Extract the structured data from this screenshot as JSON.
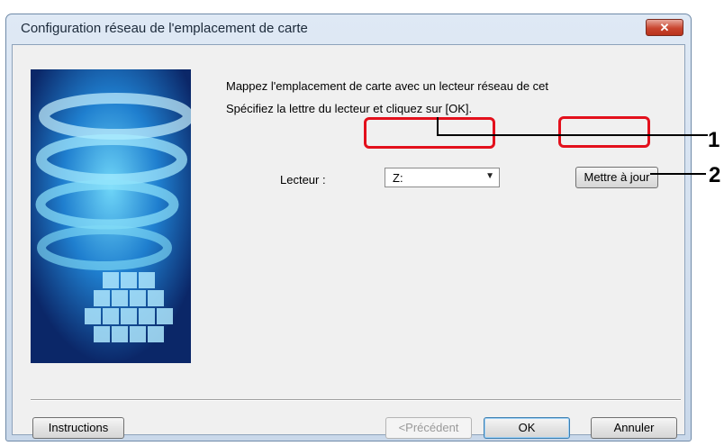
{
  "window": {
    "title": "Configuration réseau de l'emplacement de carte",
    "close_label": "✕"
  },
  "message": {
    "line1": "Mappez l'emplacement de carte avec un lecteur réseau de cet",
    "line2": "Spécifiez la lettre du lecteur et cliquez sur [OK]."
  },
  "drive": {
    "label": "Lecteur :",
    "value": "Z:"
  },
  "buttons": {
    "update": "Mettre à jour",
    "instructions": "Instructions",
    "previous": "<Précédent",
    "ok": "OK",
    "cancel": "Annuler"
  },
  "callouts": [
    "1",
    "2"
  ],
  "colors": {
    "highlight": "#e3101c"
  }
}
